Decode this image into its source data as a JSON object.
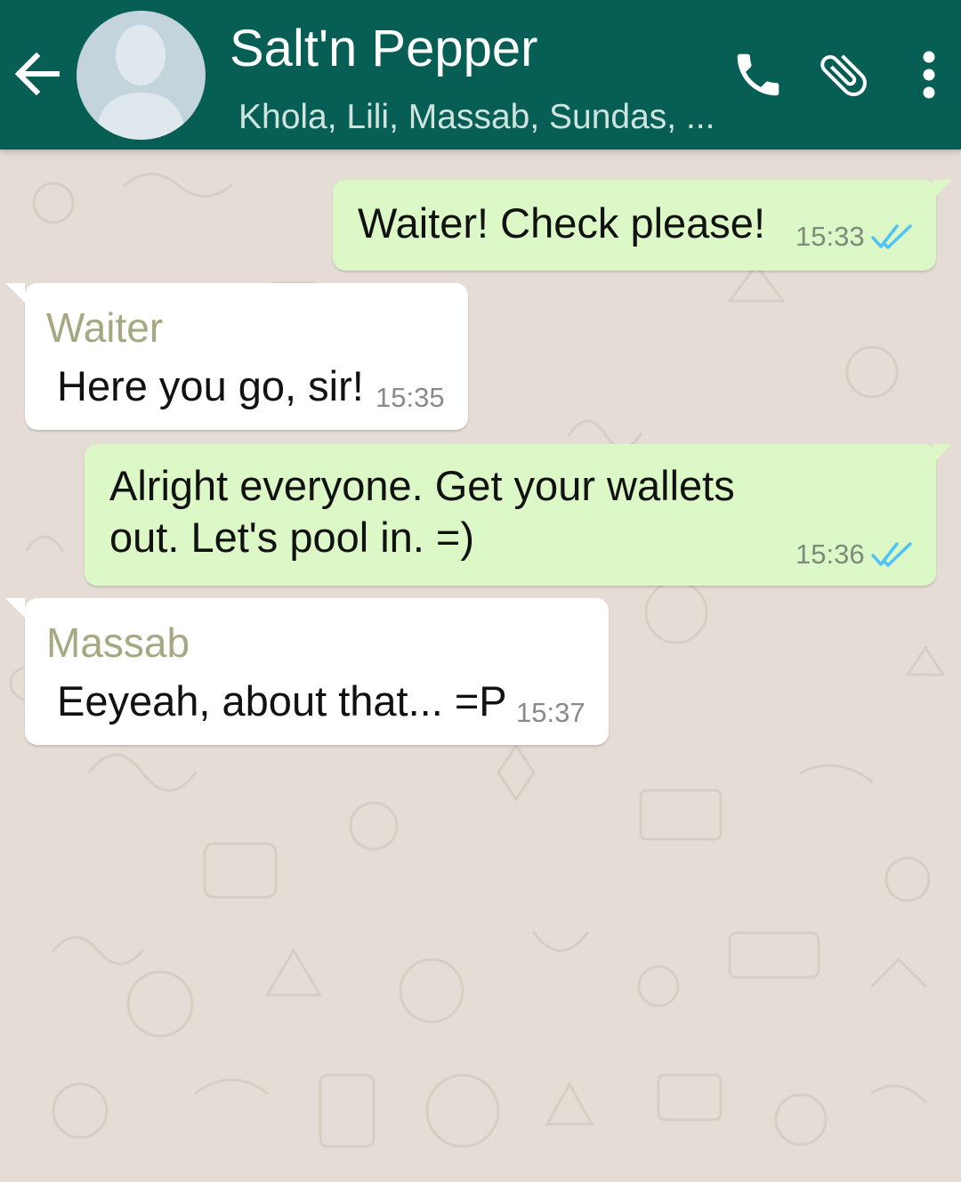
{
  "colors": {
    "header_bg": "#075e54",
    "outgoing_bubble": "#dcf8c6",
    "incoming_bubble": "#ffffff",
    "chat_background": "#e5ddd5",
    "read_ticks": "#4fc3f7",
    "sender_name": "#a6a881"
  },
  "header": {
    "back_icon": "arrow-left-icon",
    "avatar_icon": "group-avatar-placeholder",
    "title": "Salt'n Pepper",
    "subtitle": "Khola, Lili, Massab, Sundas, ...",
    "actions": [
      {
        "icon": "phone-icon"
      },
      {
        "icon": "paperclip-icon"
      },
      {
        "icon": "more-vertical-icon"
      }
    ]
  },
  "messages": [
    {
      "direction": "out",
      "text": "Waiter! Check please!",
      "time": "15:33",
      "status": "read"
    },
    {
      "direction": "in",
      "sender": "Waiter",
      "text": "Here you go, sir!",
      "time": "15:35"
    },
    {
      "direction": "out",
      "lines": [
        "Alright everyone. Get your wallets",
        "out. Let's pool in. =)"
      ],
      "time": "15:36",
      "status": "read"
    },
    {
      "direction": "in",
      "sender": "Massab",
      "text": "Eeyeah, about that... =P",
      "time": "15:37"
    }
  ]
}
